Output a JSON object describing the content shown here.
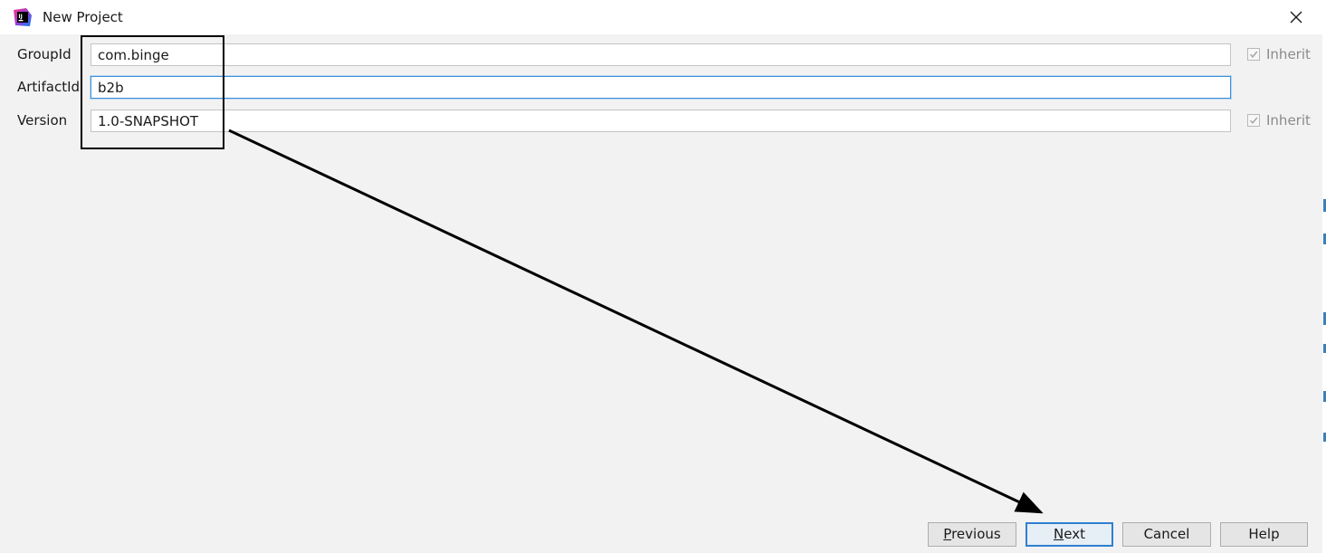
{
  "window": {
    "title": "New Project",
    "close_glyph": "✕"
  },
  "form": {
    "group_id": {
      "label": "GroupId",
      "value": "com.binge",
      "inherit_label": "Inherit",
      "inherit_checked": true
    },
    "artifact_id": {
      "label": "ArtifactId",
      "value": "b2b"
    },
    "version": {
      "label": "Version",
      "value": "1.0-SNAPSHOT",
      "inherit_label": "Inherit",
      "inherit_checked": true
    }
  },
  "buttons": {
    "previous": {
      "mnemonic": "P",
      "rest": "revious"
    },
    "next": {
      "mnemonic": "N",
      "rest": "ext"
    },
    "cancel": "Cancel",
    "help": "Help"
  },
  "icons": {
    "app": "intellij-idea-icon",
    "close": "close-icon",
    "checkbox": "checkmark-icon"
  },
  "colors": {
    "background": "#f2f2f2",
    "focus_border": "#3c8fd8",
    "annotation": "#000000",
    "disabled_text": "#8a8a8a"
  }
}
